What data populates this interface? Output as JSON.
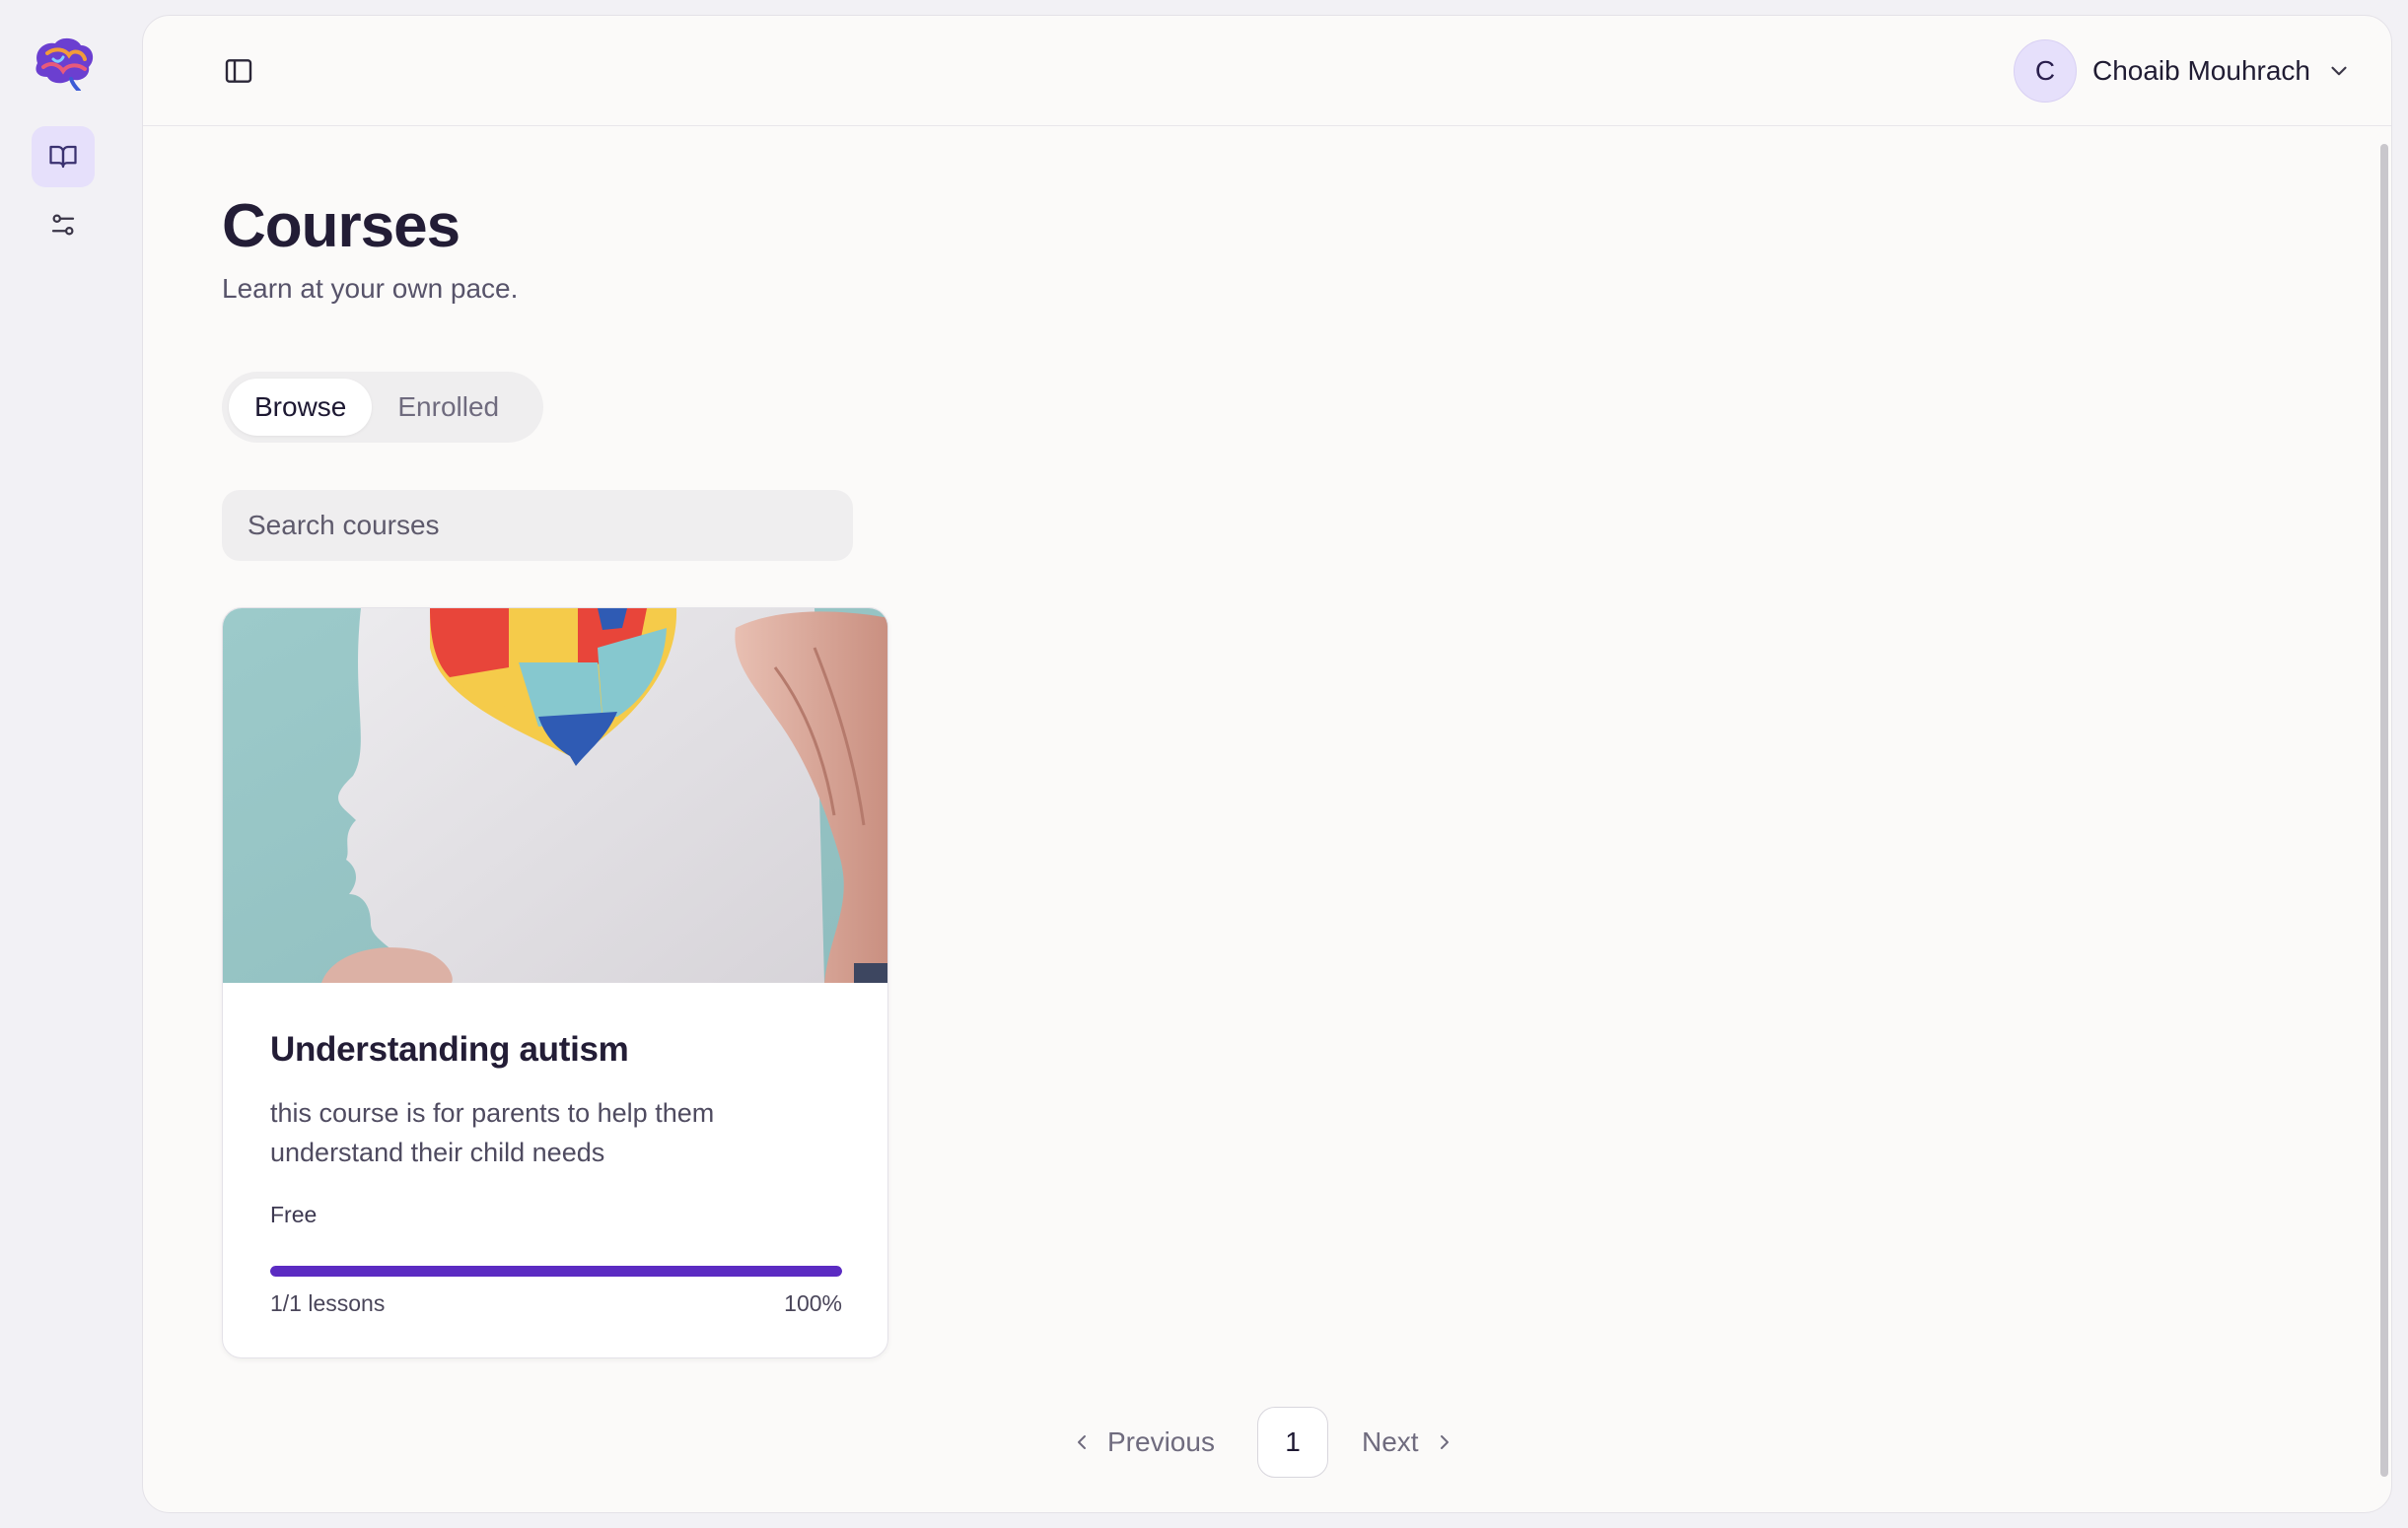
{
  "header": {
    "user": {
      "initial": "C",
      "name": "Choaib Mouhrach"
    }
  },
  "rail": {
    "items": [
      {
        "icon": "book-open-icon",
        "active": true
      },
      {
        "icon": "sliders-icon",
        "active": false
      }
    ]
  },
  "page": {
    "title": "Courses",
    "subtitle": "Learn at your own pace."
  },
  "tabs": [
    {
      "label": "Browse",
      "active": true
    },
    {
      "label": "Enrolled",
      "active": false
    }
  ],
  "search": {
    "placeholder": "Search courses",
    "value": ""
  },
  "courses": [
    {
      "title": "Understanding autism",
      "description": "this course is for parents to help them understand their child needs",
      "price": "Free",
      "lessons": "1/1 lessons",
      "progress_label": "100%",
      "progress": 1.0
    }
  ],
  "pagination": {
    "previous_label": "Previous",
    "current_page": "1",
    "next_label": "Next"
  },
  "colors": {
    "accent": "#5b2bc2",
    "accent_soft": "#e6e0fb"
  }
}
